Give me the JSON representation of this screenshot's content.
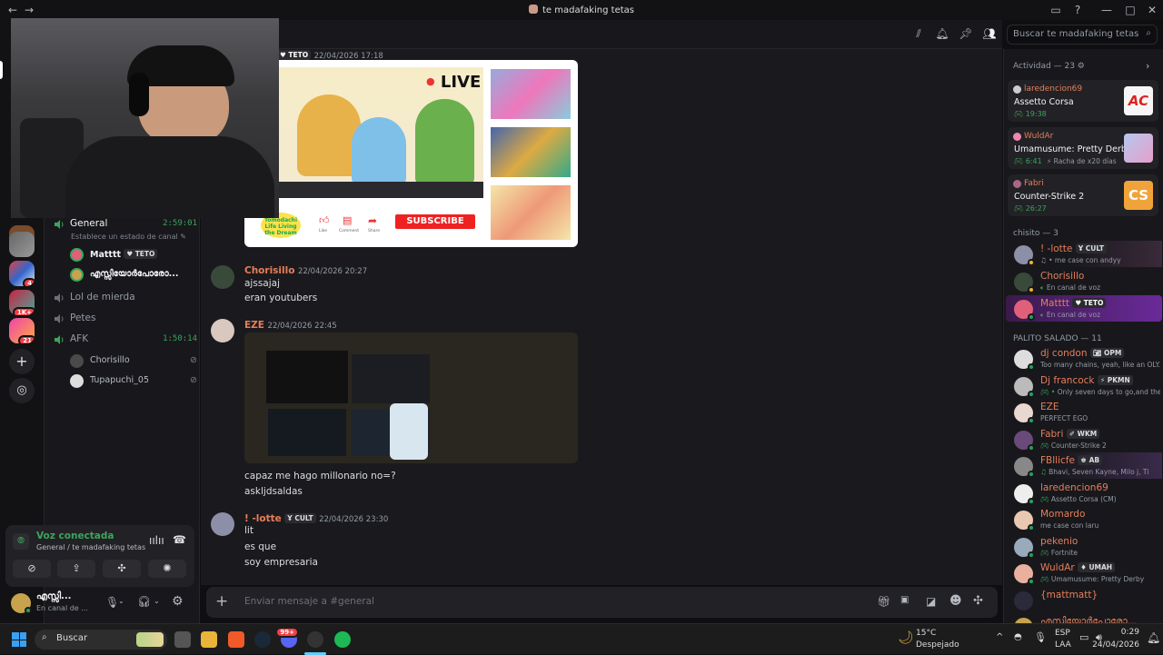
{
  "window": {
    "title": "te madafaking tetas"
  },
  "sidebar": {
    "channels": [
      {
        "name": "General",
        "time": "2:59:01",
        "status": "Establece un estado de canal"
      },
      {
        "name": "Lol de mierda"
      },
      {
        "name": "Petes"
      },
      {
        "name": "AFK",
        "time": "1:50:14"
      }
    ],
    "general_users": [
      {
        "name": "Matttt",
        "tag": "TETO"
      },
      {
        "name": "എസ്സിയോർപോരോ..."
      }
    ],
    "afk_users": [
      {
        "name": "Chorisillo"
      },
      {
        "name": "Tupapuchi_05"
      }
    ],
    "guild_badges": [
      "16",
      "4",
      "1K+",
      "21"
    ]
  },
  "voice": {
    "status": "Voz conectada",
    "location": "General / te madafaking tetas"
  },
  "user_panel": {
    "name": "എസ്സി...",
    "status": "En canal de ..."
  },
  "search": {
    "placeholder": "Buscar te madafaking tetas"
  },
  "messages": [
    {
      "author": "",
      "tag": "TETO",
      "timestamp": "22/04/2026 17:18",
      "embed": {
        "live": "LIVE",
        "subscribe": "SUBSCRIBE",
        "logo": "Tomodachi Life Living the Dream",
        "actions": [
          "Like",
          "Comment",
          "Share"
        ]
      }
    },
    {
      "author": "Chorisillo",
      "timestamp": "22/04/2026 20:27",
      "lines": [
        "ajssajaj",
        "eran youtubers"
      ]
    },
    {
      "author": "EZE",
      "timestamp": "22/04/2026 22:45",
      "lines": [
        "capaz me hago millonario no=?",
        "askljdsaldas"
      ]
    },
    {
      "author": "! -lotte",
      "tag": "CULT",
      "timestamp": "22/04/2026 23:30",
      "lines": [
        "lit",
        "es que",
        "soy empresaria"
      ]
    }
  ],
  "composer": {
    "placeholder": "Enviar mensaje a #general"
  },
  "members": {
    "activity_header": "Actividad — 23",
    "activities": [
      {
        "user": "laredencion69",
        "game": "Assetto Corsa",
        "time": "19:38",
        "extra": ""
      },
      {
        "user": "WuldAr",
        "game": "Umamusume: Pretty Derby",
        "time": "6:41",
        "extra": "Racha de x20 días"
      },
      {
        "user": "Fabri",
        "game": "Counter-Strike 2",
        "time": "26:27",
        "extra": ""
      }
    ],
    "group1_header": "chisito — 3",
    "group1": [
      {
        "name": "! -lotte",
        "tag": "CULT",
        "status": "me case con andyy"
      },
      {
        "name": "Chorisillo",
        "tag": "",
        "status": "En canal de voz"
      },
      {
        "name": "Matttt",
        "tag": "TETO",
        "status": "En canal de voz"
      }
    ],
    "group2_header": "PALITO SALADO — 11",
    "group2": [
      {
        "name": "dj condon",
        "tag": "OPM",
        "status": "Too many chains, yeah, like an OLY..."
      },
      {
        "name": "Dj francock",
        "tag": "PKMN",
        "status": "Only seven days to go,and the..."
      },
      {
        "name": "EZE",
        "tag": "",
        "status": "PERFECT EGO"
      },
      {
        "name": "Fabri",
        "tag": "WKM",
        "status": "Counter-Strike 2"
      },
      {
        "name": "FBllicfe",
        "tag": "AB",
        "status": "Bhavi, Seven Kayne, Milo j, Ti"
      },
      {
        "name": "laredencion69",
        "tag": "",
        "status": "Assetto Corsa (CM)"
      },
      {
        "name": "Momardo",
        "tag": "",
        "status": "me case con laru"
      },
      {
        "name": "pekenio",
        "tag": "",
        "status": "Fortnite"
      },
      {
        "name": "WuldAr",
        "tag": "UMAH",
        "status": "Umamusume: Pretty Derby"
      },
      {
        "name": "{mattmatt}",
        "tag": "",
        "status": ""
      },
      {
        "name": "എസ്സിയോർപോരോ...",
        "tag": "",
        "status": ""
      }
    ]
  },
  "taskbar": {
    "search": "Buscar",
    "weather_temp": "15°C",
    "weather_desc": "Despejado",
    "lang": "ESP",
    "lang2": "LAA",
    "time": "0:29",
    "date": "24/04/2026",
    "discord_badge": "99+"
  },
  "colors": {
    "accent": "#5865f2",
    "online": "#23a55a",
    "username": "#e67e5a",
    "bg": "#1a1a1e"
  }
}
